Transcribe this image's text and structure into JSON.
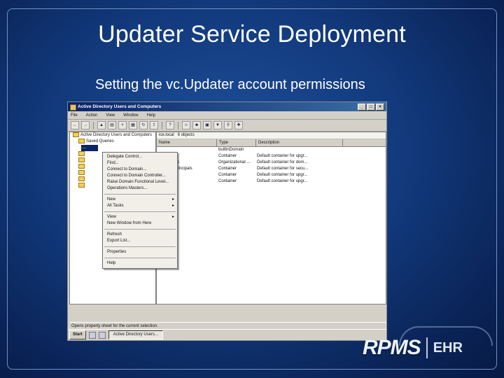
{
  "slide": {
    "title": "Updater Service Deployment",
    "subtitle": "Setting the vc.Updater account permissions"
  },
  "screenshot": {
    "window_title": "Active Directory Users and Computers",
    "menu": [
      "File",
      "Action",
      "View",
      "Window",
      "Help"
    ],
    "tree": {
      "root": "Active Directory Users and Computers",
      "items": [
        "Saved Queries",
        "..."
      ]
    },
    "list": {
      "header_label": "ice.local",
      "object_count": "6 objects",
      "columns": [
        "Name",
        "Type",
        "Description"
      ],
      "rows": [
        {
          "name": "",
          "type": "builtinDomain",
          "description": ""
        },
        {
          "name": "",
          "type": "Container",
          "description": "Default container for upgr..."
        },
        {
          "name": "Controllers",
          "type": "Organizational ...",
          "description": "Default container for dom..."
        },
        {
          "name": "SecurityPrincipals",
          "type": "Container",
          "description": "Default container for secu..."
        },
        {
          "name": "",
          "type": "Container",
          "description": "Default container for upgr..."
        },
        {
          "name": "",
          "type": "Container",
          "description": "Default container for upgr..."
        }
      ]
    },
    "context_menu": {
      "group1": [
        "Delegate Control...",
        "Find...",
        "Connect to Domain...",
        "Connect to Domain Controller...",
        "Raise Domain Functional Level...",
        "Operations Masters..."
      ],
      "group2": [
        "New",
        "All Tasks"
      ],
      "group3": [
        "View",
        "New Window from Here"
      ],
      "group4": [
        "Refresh",
        "Export List..."
      ],
      "group5": [
        "Properties"
      ],
      "group6": [
        "Help"
      ]
    },
    "status_text": "Opens property sheet for the current selection.",
    "taskbar": {
      "start_label": "Start",
      "task_label": "Active Directory Users..."
    }
  },
  "logo": {
    "brand": "RPMS",
    "suffix": "EHR"
  }
}
